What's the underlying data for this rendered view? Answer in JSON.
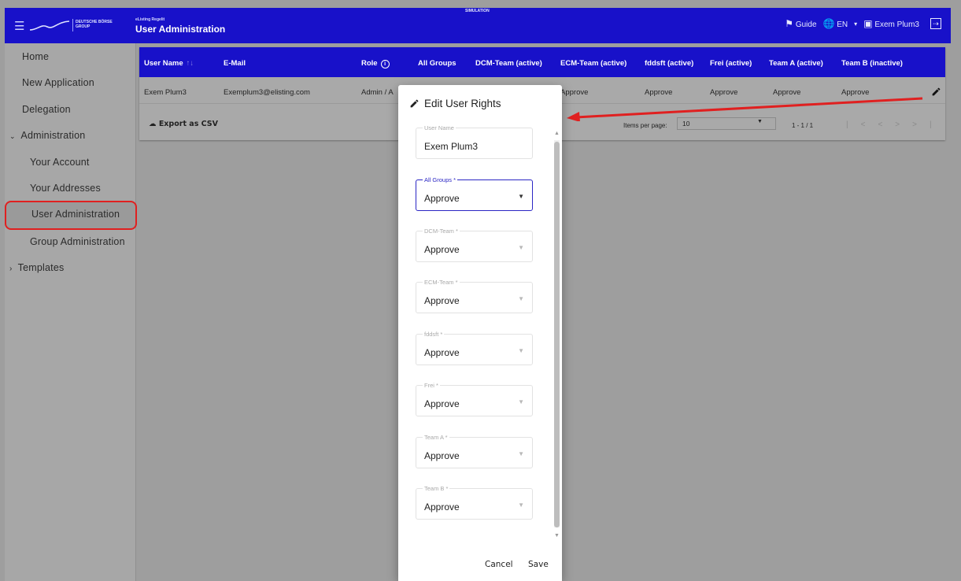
{
  "header": {
    "logo_text": "DEUTSCHE BÖRSE GROUP",
    "app_small": "eListing Regelit",
    "app_title": "User Administration",
    "mode_label": "SIMULATION",
    "guide_label": "Guide",
    "language": "EN",
    "user_name": "Exem Plum3"
  },
  "sidebar": {
    "home": "Home",
    "new_application": "New Application",
    "delegation": "Delegation",
    "administration": "Administration",
    "your_account": "Your Account",
    "your_addresses": "Your Addresses",
    "user_administration": "User Administration",
    "group_administration": "Group Administration",
    "templates": "Templates"
  },
  "table": {
    "columns": [
      "User Name",
      "E-Mail",
      "Role",
      "All Groups",
      "DCM-Team (active)",
      "ECM-Team (active)",
      "fddsft (active)",
      "Frei (active)",
      "Team A (active)",
      "Team B (inactive)"
    ],
    "row": {
      "user_name": "Exem Plum3",
      "email": "Exemplum3@elisting.com",
      "role": "Admin / A",
      "ecm": "Approve",
      "fddsft": "Approve",
      "frei": "Approve",
      "team_a": "Approve",
      "team_b": "Approve"
    },
    "export_label": "Export as CSV",
    "items_per_page_label": "Items per page:",
    "items_per_page_value": "10",
    "range_label": "1 - 1 / 1"
  },
  "dialog": {
    "title": "Edit User Rights",
    "fields": [
      {
        "label": "User Name",
        "value": "Exem Plum3"
      },
      {
        "label": "All Groups *",
        "value": "Approve"
      },
      {
        "label": "DCM-Team *",
        "value": "Approve"
      },
      {
        "label": "ECM-Team *",
        "value": "Approve"
      },
      {
        "label": "fddsft *",
        "value": "Approve"
      },
      {
        "label": "Frei *",
        "value": "Approve"
      },
      {
        "label": "Team A *",
        "value": "Approve"
      },
      {
        "label": "Team B *",
        "value": "Approve"
      }
    ],
    "cancel_label": "Cancel",
    "save_label": "Save"
  },
  "colors": {
    "brand_blue": "#1811c9",
    "highlight_red": "#e02020"
  }
}
